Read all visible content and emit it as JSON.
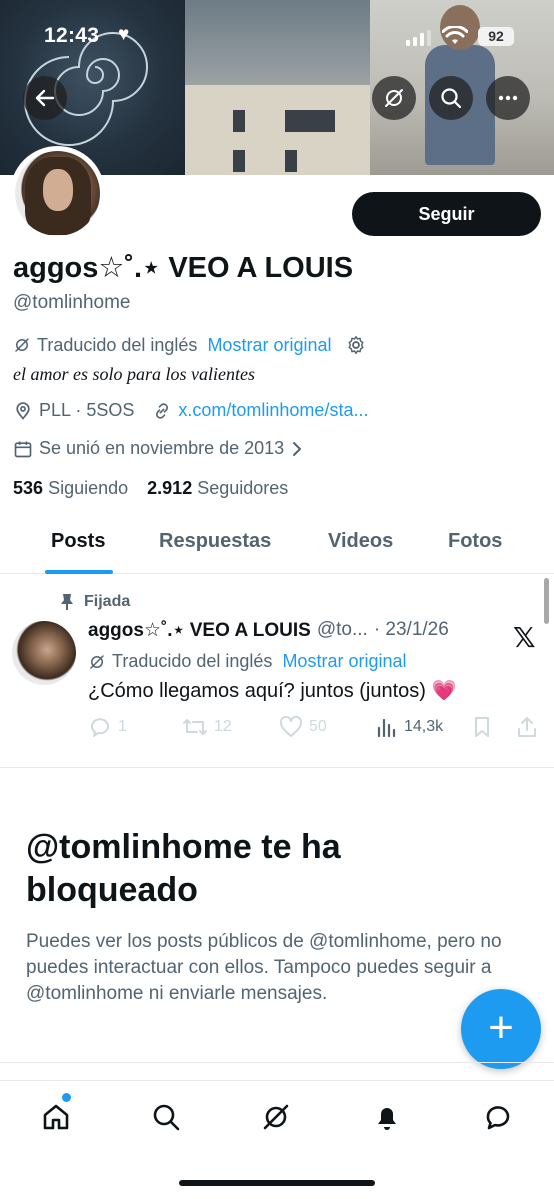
{
  "status_bar": {
    "time": "12:43",
    "battery": "92"
  },
  "header": {
    "follow_label": "Seguir"
  },
  "profile": {
    "display_name": "aggos☆˚.⋆ VEO A LOUIS",
    "handle": "@tomlinhome",
    "translated_label": "Traducido del inglés",
    "show_original": "Mostrar original",
    "bio": "el amor es solo para los valientes",
    "location": "PLL · 5SOS",
    "website": "x.com/tomlinhome/sta...",
    "joined": "Se unió en noviembre de 2013",
    "following_count": "536",
    "following_label": "Siguiendo",
    "followers_count": "2.912",
    "followers_label": "Seguidores"
  },
  "tabs": [
    {
      "label": "Posts"
    },
    {
      "label": "Respuestas"
    },
    {
      "label": "Videos"
    },
    {
      "label": "Fotos"
    }
  ],
  "pinned_post": {
    "pinned_label": "Fijada",
    "name": "aggos☆˚.⋆ VEO A LOUIS",
    "handle": "@to...",
    "date": "· 23/1/26",
    "translated_label": "Traducido del inglés",
    "show_original": "Mostrar original",
    "text": "¿Cómo llegamos aquí? juntos (juntos)",
    "emoji": "💗",
    "replies": "1",
    "reposts": "12",
    "likes": "50",
    "views": "14,3k"
  },
  "blocked": {
    "title": "@tomlinhome te ha bloqueado",
    "description": "Puedes ver los posts públicos de @tomlinhome, pero no puedes interactuar con ellos. Tampoco puedes seguir a @tomlinhome ni enviarle mensajes."
  },
  "fab": {
    "label": "+"
  },
  "colors": {
    "accent": "#1d9bf0",
    "text": "#0f1419",
    "muted": "#536471"
  }
}
